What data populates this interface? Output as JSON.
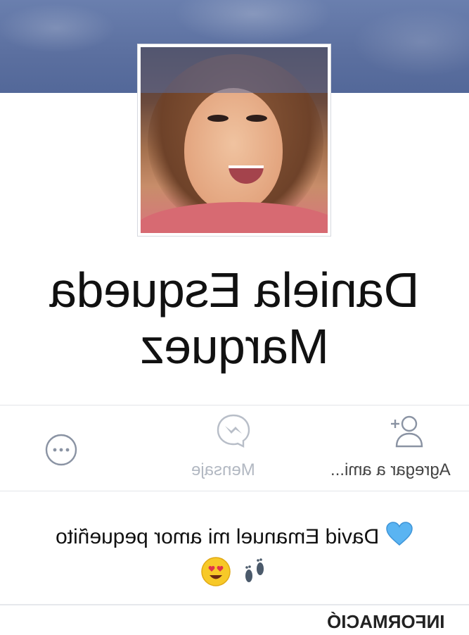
{
  "profile": {
    "name_line1": "Daniela Esqueda",
    "name_line2": "Marquez"
  },
  "actions": {
    "add_friend_label": "Agregar a ami...",
    "message_label": "Mensaje",
    "more_icon": "more-icon",
    "add_friend_icon": "add-friend-icon",
    "message_icon": "messenger-icon"
  },
  "bio": {
    "text": "David Emanuel mi amor pequeñito",
    "emojis": [
      "blue-heart",
      "heart-eyes",
      "footprints"
    ]
  },
  "tabs": {
    "info_label": "INFORMACIÓ"
  },
  "colors": {
    "cover": "#5b6f9f",
    "icon_gray": "#8a93a3",
    "text": "#111111"
  }
}
